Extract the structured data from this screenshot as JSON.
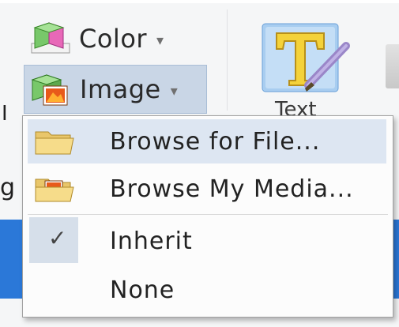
{
  "ribbon": {
    "color_button": {
      "label": "Color",
      "caret": "▾"
    },
    "image_button": {
      "label": "Image",
      "caret": "▾"
    },
    "text_button": {
      "label": "Text"
    },
    "stray_left_top": "I",
    "stray_left_bottom": "g"
  },
  "menu": {
    "items": [
      {
        "label": "Browse for File...",
        "icon": "folder-icon",
        "highlighted": true
      },
      {
        "label": "Browse My Media...",
        "icon": "folder-media-icon",
        "highlighted": false
      },
      {
        "label": "Inherit",
        "checked": true
      },
      {
        "label": "None",
        "checked": false
      }
    ],
    "check_glyph": "✓"
  },
  "colors": {
    "accent_blue": "#2b78d8",
    "selected_bg": "#c9d6e6",
    "hover_bg": "#dde6f2"
  }
}
